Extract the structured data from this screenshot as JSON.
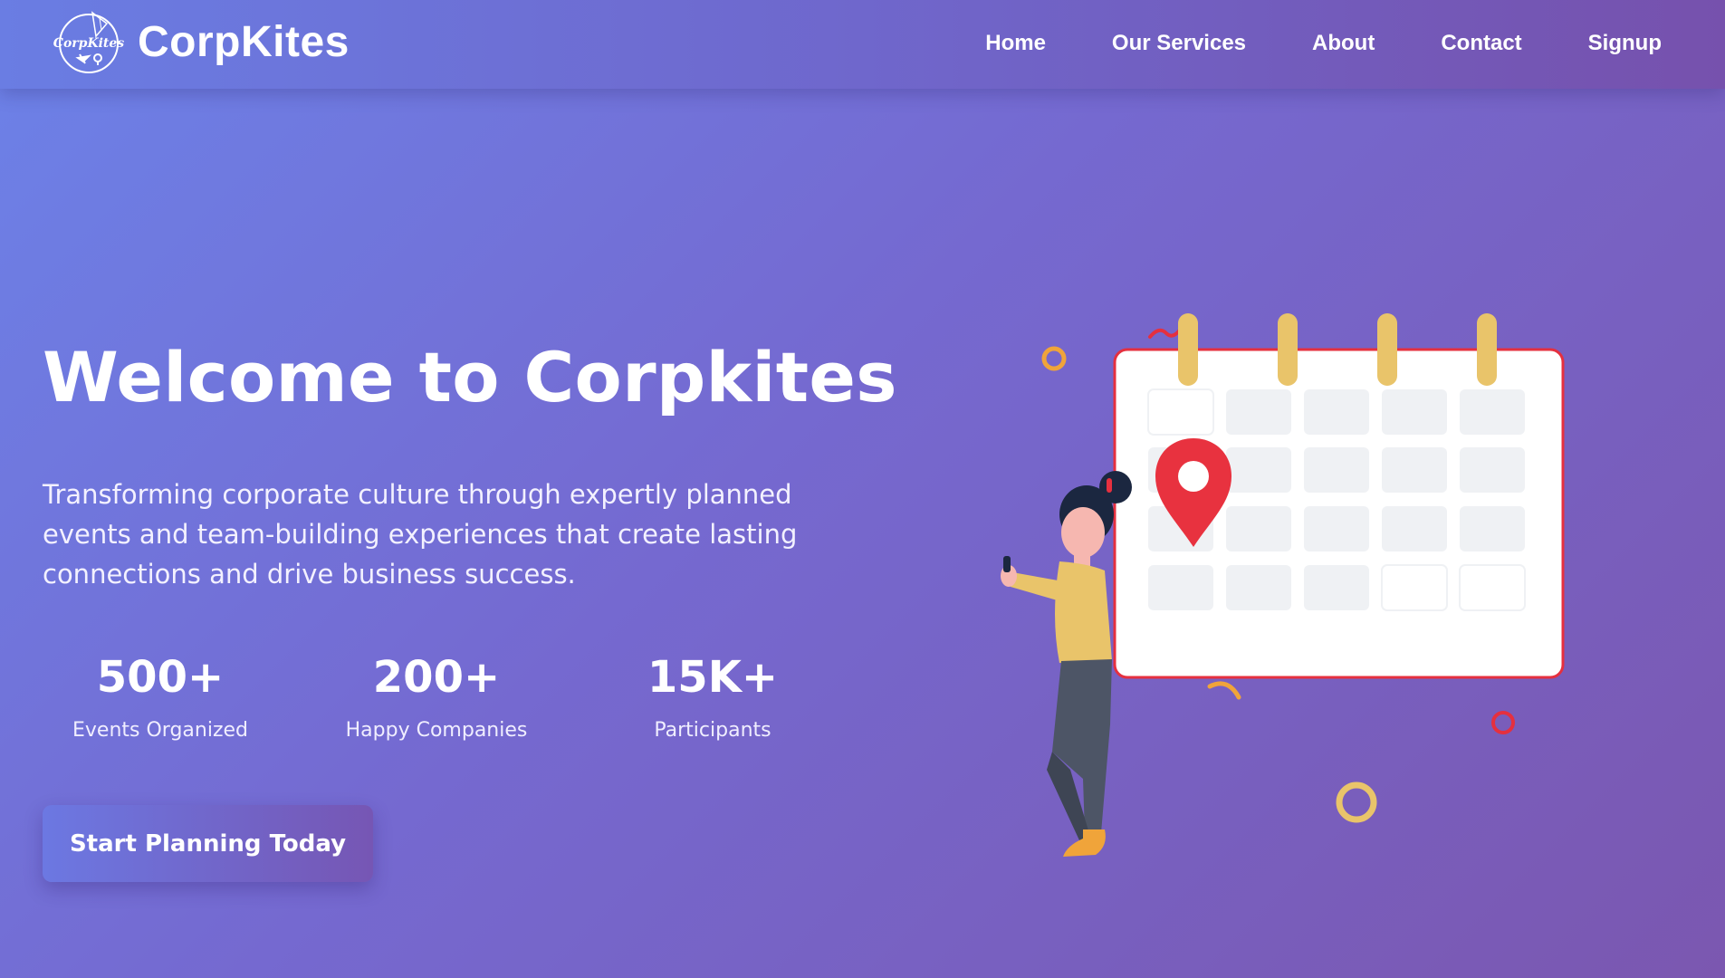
{
  "brand": {
    "logo_text": "CorpKites",
    "name": "CorpKites"
  },
  "nav": {
    "items": [
      "Home",
      "Our Services",
      "About",
      "Contact",
      "Signup"
    ]
  },
  "hero": {
    "title": "Welcome to Corpkites",
    "subtitle": "Transforming corporate culture through expertly planned events and team-building experiences that create lasting connections and drive business success.",
    "cta_label": "Start Planning Today"
  },
  "stats": [
    {
      "value": "500+",
      "label": "Events Organized"
    },
    {
      "value": "200+",
      "label": "Happy Companies"
    },
    {
      "value": "15K+",
      "label": "Participants"
    }
  ],
  "illustration": {
    "icons": [
      "calendar-icon",
      "location-pin-icon",
      "person-with-phone"
    ],
    "colors": {
      "calendar_border": "#e5303f",
      "calendar_rings": "#e9c46a",
      "pin": "#e8323f",
      "shirt": "#e9c46a",
      "pants": "#4d5566",
      "hair": "#1b2740",
      "skin": "#f6b7b0"
    }
  },
  "colors": {
    "bg_start": "#6c82e8",
    "bg_end": "#7b57b0",
    "text": "#ffffff"
  }
}
